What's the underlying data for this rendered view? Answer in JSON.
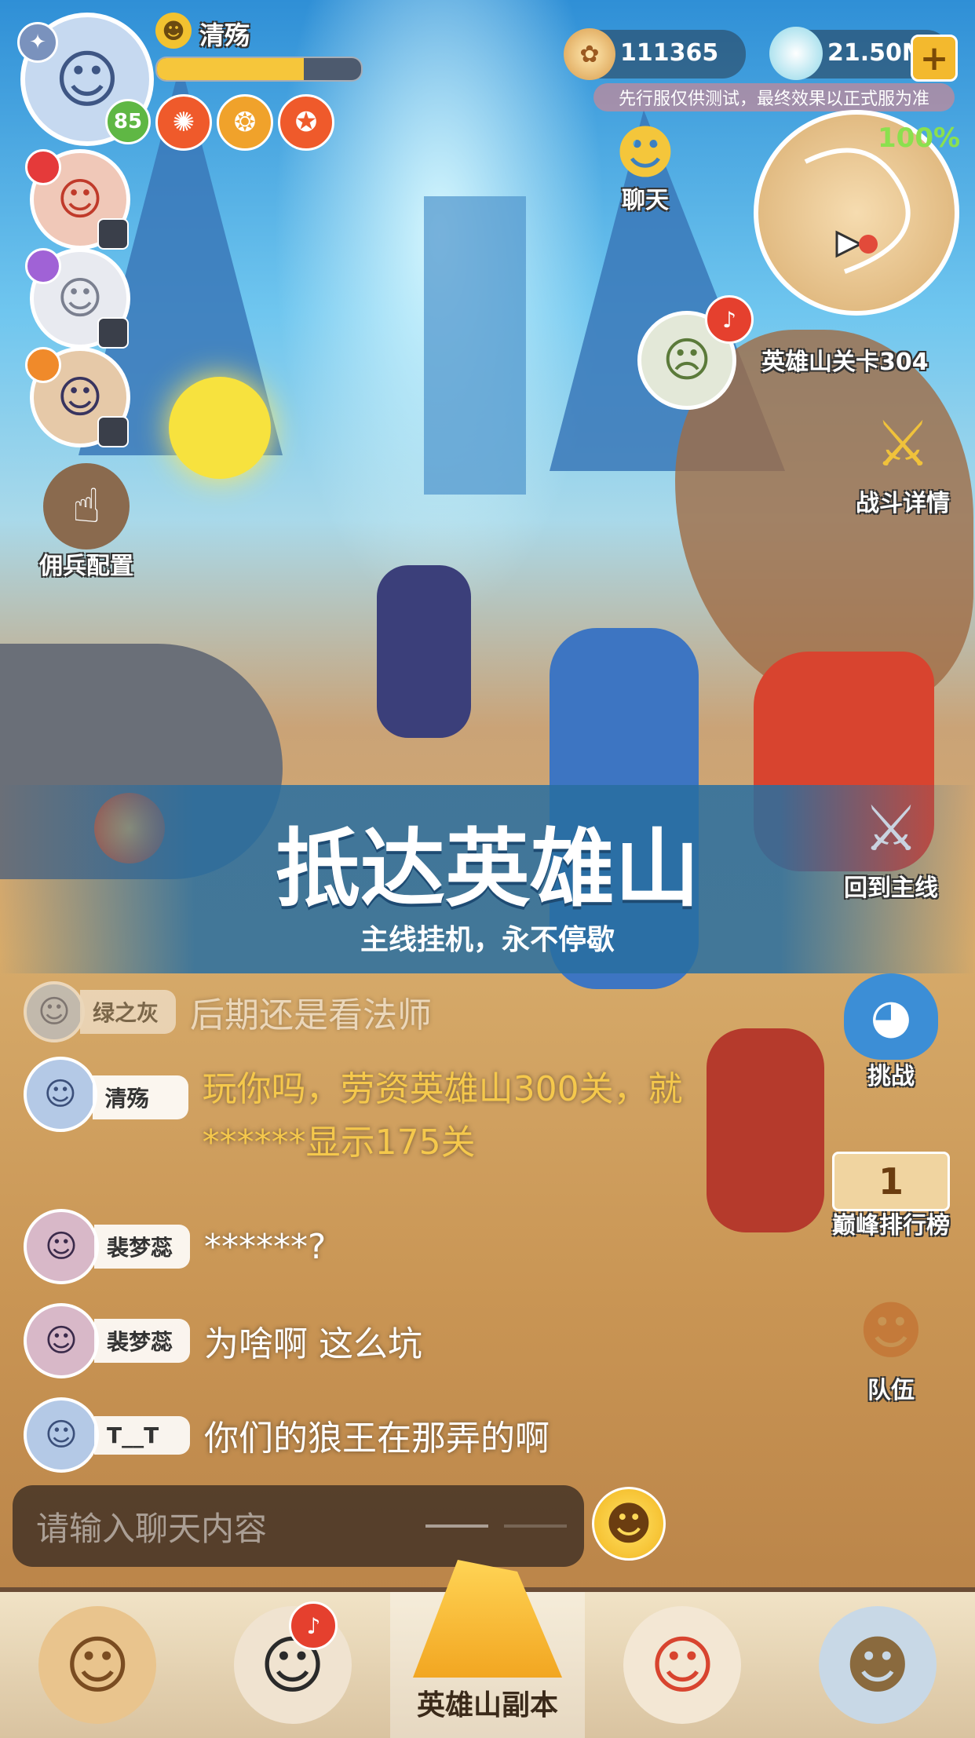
{
  "player": {
    "name": "清殇",
    "level": "85",
    "xp_fill": 0.72
  },
  "currency": {
    "gold": "111365",
    "gems": "21.50M",
    "add_symbol": "+"
  },
  "notice": "先行服仅供测试，最终效果以正式服为准",
  "minimap": {
    "progress": "100%",
    "stage": "英雄山关卡304"
  },
  "chat_button": "聊天",
  "buttons": {
    "mercenary": "佣兵配置",
    "battle_details": "战斗详情",
    "return_main": "回到主线",
    "challenge": "挑战",
    "leaderboard": "巅峰排行榜",
    "leaderboard_rank": "1",
    "team": "队伍"
  },
  "banner": {
    "title": "抵达英雄山",
    "subtitle": "主线挂机，永不停歇"
  },
  "chat": [
    {
      "name": "绿之灰",
      "message": "后期还是看法师",
      "color": "#ffffff"
    },
    {
      "name": "清殇",
      "message": "玩你吗，劳资英雄山300关，就******显示175关",
      "color": "#f5c84c"
    },
    {
      "name": "裴梦蕊",
      "message": "******?",
      "color": "#ffffff"
    },
    {
      "name": "裴梦蕊",
      "message": "为啥啊 这么坑",
      "color": "#ffffff"
    },
    {
      "name": "T__T",
      "message": "你们的狼王在那弄的啊",
      "color": "#ffffff"
    }
  ],
  "chat_input": {
    "placeholder": "请输入聊天内容"
  },
  "bottom_nav": {
    "active_label": "英雄山副本"
  },
  "colors": {
    "accent_orange": "#ef5a2b",
    "gold_text": "#f5c84c",
    "progress_green": "#8be04e"
  }
}
